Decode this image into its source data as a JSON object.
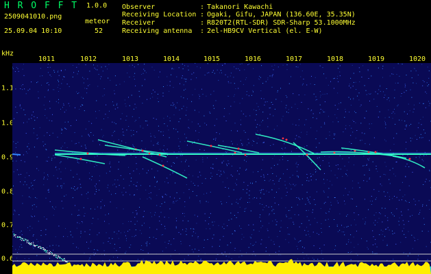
{
  "header": {
    "app_title": "H R O F F T",
    "version": "1.0.0",
    "filename": "2509041010.png",
    "meteor_label": "meteor",
    "timestamp": "25.09.04 10:10",
    "meteor_count": "52"
  },
  "info": [
    {
      "label": "Observer",
      "value": "Takanori Kawachi"
    },
    {
      "label": "Receiving Location",
      "value": "Ogaki, Gifu, JAPAN (136.60E, 35.35N)"
    },
    {
      "label": "Receiver",
      "value": "R820T2(RTL-SDR) SDR-Sharp 53.1000MHz"
    },
    {
      "label": "Receiving antenna",
      "value": "2el-HB9CV Vertical (el. E-W)"
    }
  ],
  "separator": ":",
  "axis": {
    "y_unit": "kHz",
    "x_ticks": [
      "1011",
      "1012",
      "1013",
      "1014",
      "1015",
      "1016",
      "1017",
      "1018",
      "1019",
      "1020"
    ],
    "y_ticks": [
      "1.1",
      "1.0",
      "0.9",
      "0.8",
      "0.7",
      "0.6"
    ]
  },
  "colors": {
    "text": "#ffff33",
    "title": "#00ff66",
    "background": "#000000",
    "spectrogram_bg": "#0a0a55",
    "signal_strong": "#ff3344",
    "signal_mid": "#33ffcc",
    "signal_weak": "#3388ff",
    "baseline_fill": "#00ccff",
    "noise_level": "#ffee00",
    "threshold_line": "#cccccc"
  }
}
